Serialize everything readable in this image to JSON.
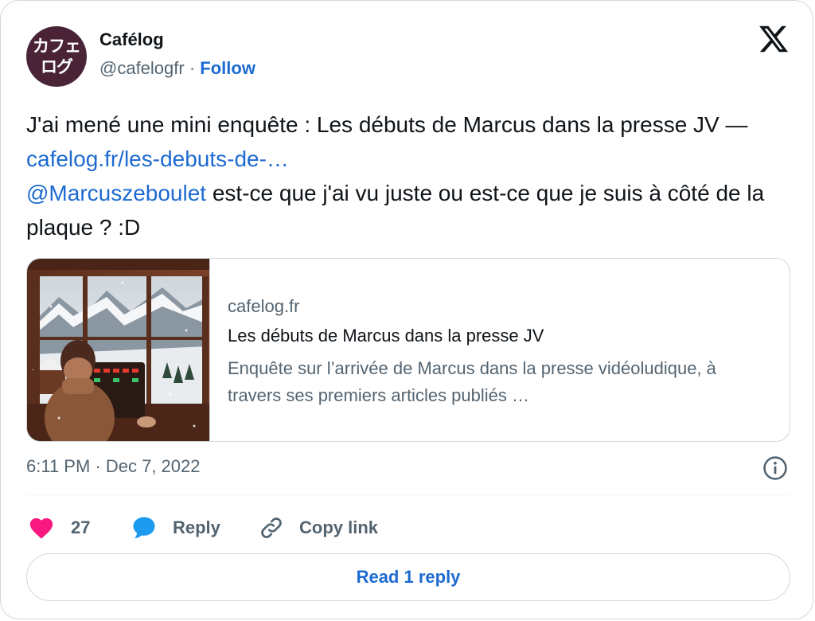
{
  "author": {
    "name": "Cafélog",
    "handle": "@cafelogfr",
    "separator": "·",
    "follow_label": "Follow",
    "avatar_text": [
      "カフェ",
      "ログ"
    ]
  },
  "tweet": {
    "text_part1": "J'ai mené une mini enquête : Les débuts de Marcus dans la presse JV — ",
    "link": "cafelog.fr/les-debuts-de-…",
    "mention": "@Marcuszeboulet",
    "text_part2": " est-ce que j'ai vu juste ou est-ce que je suis à côté de la plaque ? :D"
  },
  "link_card": {
    "domain": "cafelog.fr",
    "title": "Les débuts de Marcus dans la presse JV",
    "description": "Enquête sur l’arrivée de Marcus dans la presse vidéoludique, à travers ses premiers articles publiés …"
  },
  "timestamp": "6:11 PM · Dec 7, 2022",
  "actions": {
    "like_count": "27",
    "reply_label": "Reply",
    "copy_label": "Copy link"
  },
  "read_replies_label": "Read 1 reply",
  "colors": {
    "accent": "#1d6ad1",
    "like": "#f91880",
    "reply_icon": "#1d9bf0",
    "muted": "#536471",
    "border": "#cfd9de",
    "avatar_bg": "#4a2436"
  },
  "icons": {
    "logo": "x-logo-icon",
    "like": "heart-icon",
    "reply": "speech-bubble-icon",
    "copy": "link-icon",
    "info": "info-icon"
  }
}
